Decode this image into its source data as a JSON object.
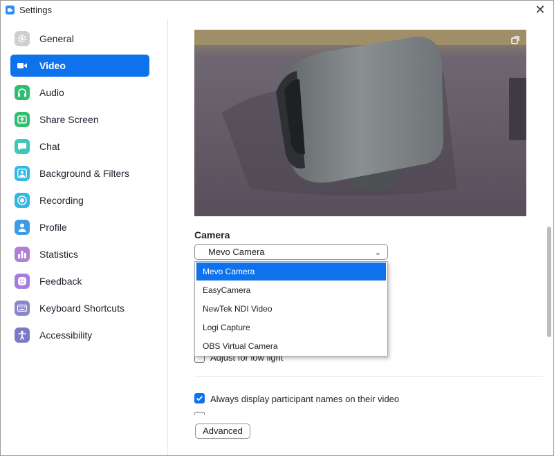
{
  "window": {
    "title": "Settings"
  },
  "sidebar": {
    "items": [
      {
        "label": "General",
        "icon": "gear-icon",
        "color": "#cfcfcf"
      },
      {
        "label": "Video",
        "icon": "video-camera-icon",
        "color": "#0e72ed",
        "active": true
      },
      {
        "label": "Audio",
        "icon": "headphones-icon",
        "color": "#2fbf71"
      },
      {
        "label": "Share Screen",
        "icon": "share-screen-icon",
        "color": "#2fbf71"
      },
      {
        "label": "Chat",
        "icon": "chat-bubble-icon",
        "color": "#3ec7b8"
      },
      {
        "label": "Background & Filters",
        "icon": "background-person-icon",
        "color": "#33b8e6"
      },
      {
        "label": "Recording",
        "icon": "record-icon",
        "color": "#33b8e6"
      },
      {
        "label": "Profile",
        "icon": "profile-person-icon",
        "color": "#3d9be9"
      },
      {
        "label": "Statistics",
        "icon": "bar-chart-icon",
        "color": "#b07fd6"
      },
      {
        "label": "Feedback",
        "icon": "smiley-icon",
        "color": "#a67ce0"
      },
      {
        "label": "Keyboard Shortcuts",
        "icon": "keyboard-icon",
        "color": "#8b85c9"
      },
      {
        "label": "Accessibility",
        "icon": "accessibility-icon",
        "color": "#7a7ac6"
      }
    ]
  },
  "camera": {
    "label": "Camera",
    "selected": "Mevo Camera",
    "options": [
      "Mevo Camera",
      "EasyCamera",
      "NewTek NDI Video",
      "Logi Capture",
      "OBS Virtual Camera"
    ]
  },
  "settings": {
    "adjust_low_light": {
      "label": "Adjust for low light",
      "checked": false
    },
    "display_names": {
      "label": "Always display participant names on their video",
      "checked": true
    }
  },
  "buttons": {
    "advanced": "Advanced"
  },
  "colors": {
    "accent": "#0e72ed"
  }
}
